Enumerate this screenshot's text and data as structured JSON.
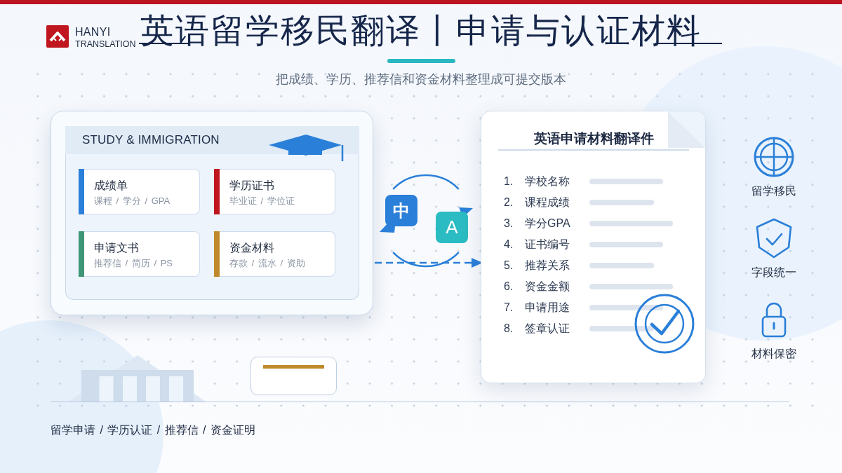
{
  "header": {
    "logo": {
      "name": "HANYI",
      "tagline": "TRANSLATION"
    },
    "title": "英语留学移民翻译丨申请与认证材料",
    "subtitle": "把成绩、学历、推荐信和资金材料整理成可提交版本"
  },
  "source_card": {
    "heading": "STUDY & IMMIGRATION",
    "tiles": [
      {
        "title": "成绩单",
        "detail": "课程 / 学分 / GPA",
        "color": "#2a7fd8"
      },
      {
        "title": "学历证书",
        "detail": "毕业证 / 学位证",
        "color": "#c0161f"
      },
      {
        "title": "申请文书",
        "detail": "推荐信 / 简历 / PS",
        "color": "#3f9676"
      },
      {
        "title": "资金材料",
        "detail": "存款 / 流水 / 资助",
        "color": "#c08a2c"
      }
    ]
  },
  "translation": {
    "source": "中",
    "target": "A"
  },
  "document": {
    "title": "英语申请材料翻译件",
    "fields": [
      {
        "number": "1.",
        "label": "学校名称"
      },
      {
        "number": "2.",
        "label": "课程成绩"
      },
      {
        "number": "3.",
        "label": "学分GPA"
      },
      {
        "number": "4.",
        "label": "证书编号"
      },
      {
        "number": "5.",
        "label": "推荐关系"
      },
      {
        "number": "6.",
        "label": "资金金额"
      },
      {
        "number": "7.",
        "label": "申请用途"
      },
      {
        "number": "8.",
        "label": "签章认证"
      }
    ]
  },
  "features": [
    {
      "kind": "globe",
      "label": "留学移民"
    },
    {
      "kind": "shield",
      "label": "字段统一"
    },
    {
      "kind": "lock",
      "label": "材料保密"
    }
  ],
  "footer": {
    "tags": "留学申请 / 学历认证 / 推荐信 / 资金证明"
  }
}
